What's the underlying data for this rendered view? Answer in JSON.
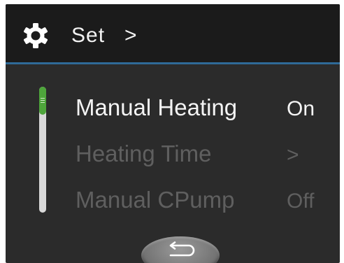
{
  "header": {
    "icon": "gear-icon",
    "title": "Set",
    "chevron": ">"
  },
  "menu": {
    "items": [
      {
        "label": "Manual Heating",
        "value": "On",
        "state": "active"
      },
      {
        "label": "Heating Time",
        "value": ">",
        "state": "inactive"
      },
      {
        "label": "Manual CPump",
        "value": "Off",
        "state": "inactive"
      }
    ]
  },
  "back_button": {
    "icon": "return-arrow-icon"
  },
  "colors": {
    "screen_background": "#2b2b2b",
    "header_background": "#1b1b1b",
    "header_rule": "#2f6a98",
    "active_text": "#f4f4f4",
    "inactive_text": "#5f5f5f",
    "scroll_thumb": "#4ea53b",
    "scroll_track": "#d9d9d9"
  }
}
